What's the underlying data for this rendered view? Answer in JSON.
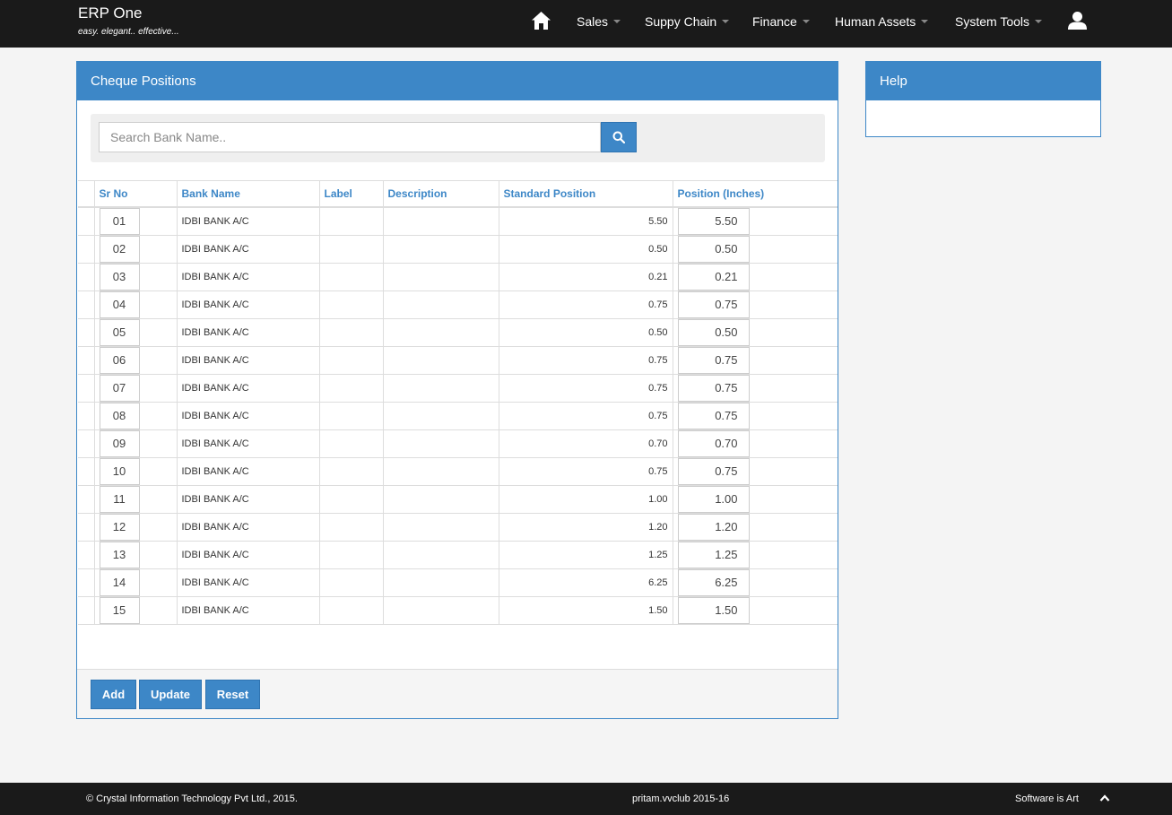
{
  "brand": {
    "title": "ERP One",
    "tagline": "easy. elegant.. effective..."
  },
  "nav": {
    "items": [
      {
        "label": "Sales"
      },
      {
        "label": "Suppy Chain"
      },
      {
        "label": "Finance"
      },
      {
        "label": "Human Assets"
      },
      {
        "label": "System Tools"
      }
    ],
    "icons": {
      "home": "home-icon",
      "user": "user-icon"
    }
  },
  "panel": {
    "title": "Cheque Positions",
    "search": {
      "placeholder": "Search Bank Name..",
      "value": "",
      "icon": "search-icon"
    },
    "columns": [
      "Sr No",
      "Bank Name",
      "Label",
      "Description",
      "Standard Position",
      "Position (Inches)"
    ],
    "rows": [
      {
        "sr": "01",
        "bank": "IDBI BANK A/C",
        "label": "",
        "description": "",
        "standard": "5.50",
        "position": "5.50"
      },
      {
        "sr": "02",
        "bank": "IDBI BANK A/C",
        "label": "",
        "description": "",
        "standard": "0.50",
        "position": "0.50"
      },
      {
        "sr": "03",
        "bank": "IDBI BANK A/C",
        "label": "",
        "description": "",
        "standard": "0.21",
        "position": "0.21"
      },
      {
        "sr": "04",
        "bank": "IDBI BANK A/C",
        "label": "",
        "description": "",
        "standard": "0.75",
        "position": "0.75"
      },
      {
        "sr": "05",
        "bank": "IDBI BANK A/C",
        "label": "",
        "description": "",
        "standard": "0.50",
        "position": "0.50"
      },
      {
        "sr": "06",
        "bank": "IDBI BANK A/C",
        "label": "",
        "description": "",
        "standard": "0.75",
        "position": "0.75"
      },
      {
        "sr": "07",
        "bank": "IDBI BANK A/C",
        "label": "",
        "description": "",
        "standard": "0.75",
        "position": "0.75"
      },
      {
        "sr": "08",
        "bank": "IDBI BANK A/C",
        "label": "",
        "description": "",
        "standard": "0.75",
        "position": "0.75"
      },
      {
        "sr": "09",
        "bank": "IDBI BANK A/C",
        "label": "",
        "description": "",
        "standard": "0.70",
        "position": "0.70"
      },
      {
        "sr": "10",
        "bank": "IDBI BANK A/C",
        "label": "",
        "description": "",
        "standard": "0.75",
        "position": "0.75"
      },
      {
        "sr": "11",
        "bank": "IDBI BANK A/C",
        "label": "",
        "description": "",
        "standard": "1.00",
        "position": "1.00"
      },
      {
        "sr": "12",
        "bank": "IDBI BANK A/C",
        "label": "",
        "description": "",
        "standard": "1.20",
        "position": "1.20"
      },
      {
        "sr": "13",
        "bank": "IDBI BANK A/C",
        "label": "",
        "description": "",
        "standard": "1.25",
        "position": "1.25"
      },
      {
        "sr": "14",
        "bank": "IDBI BANK A/C",
        "label": "",
        "description": "",
        "standard": "6.25",
        "position": "6.25"
      },
      {
        "sr": "15",
        "bank": "IDBI BANK A/C",
        "label": "",
        "description": "",
        "standard": "1.50",
        "position": "1.50"
      }
    ],
    "buttons": {
      "add": "Add",
      "update": "Update",
      "reset": "Reset"
    }
  },
  "help": {
    "title": "Help"
  },
  "footer": {
    "copyright": "© Crystal Information Technology Pvt Ltd., 2015.",
    "session": "pritam.vvclub 2015-16",
    "motto": "Software is Art",
    "icon": "chevron-up-icon"
  },
  "colors": {
    "primary": "#3d87c7",
    "nav_bg": "#1a1a1a",
    "page_bg": "#f4f4f4"
  }
}
